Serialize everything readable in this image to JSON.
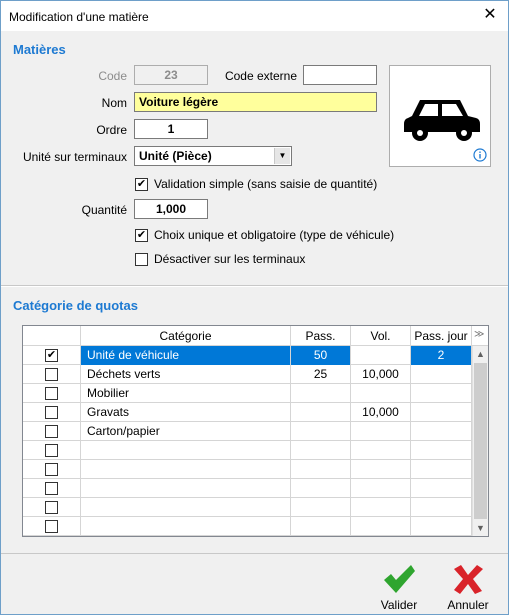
{
  "window": {
    "title": "Modification d'une matière",
    "close_glyph": "✕"
  },
  "matieres": {
    "section_title": "Matières",
    "code_label": "Code",
    "code_value": "23",
    "code_externe_label": "Code externe",
    "code_externe_value": "",
    "nom_label": "Nom",
    "nom_value": "Voiture légère",
    "ordre_label": "Ordre",
    "ordre_value": "1",
    "unite_label": "Unité sur terminaux",
    "unite_value": "Unité (Pièce)",
    "validation_simple_label": "Validation simple (sans saisie de quantité)",
    "validation_simple_checked": true,
    "quantite_label": "Quantité",
    "quantite_value": "1,000",
    "choix_unique_label": "Choix unique et obligatoire (type de véhicule)",
    "choix_unique_checked": true,
    "desactiver_label": "Désactiver sur les terminaux",
    "desactiver_checked": false,
    "image_icon": "car-icon",
    "info_icon": "info-icon"
  },
  "quotas": {
    "section_title": "Catégorie de quotas",
    "columns": [
      "",
      "Catégorie",
      "Pass.",
      "Vol.",
      "Pass. jour"
    ],
    "rows": [
      {
        "checked": true,
        "categorie": "Unité de véhicule",
        "pass": "50",
        "vol": "",
        "pass_jour": "2",
        "selected": true
      },
      {
        "checked": false,
        "categorie": "Déchets verts",
        "pass": "25",
        "vol": "10,000",
        "pass_jour": ""
      },
      {
        "checked": false,
        "categorie": "Mobilier",
        "pass": "",
        "vol": "",
        "pass_jour": ""
      },
      {
        "checked": false,
        "categorie": "Gravats",
        "pass": "",
        "vol": "10,000",
        "pass_jour": ""
      },
      {
        "checked": false,
        "categorie": "Carton/papier",
        "pass": "",
        "vol": "",
        "pass_jour": ""
      },
      {
        "checked": false,
        "categorie": "",
        "pass": "",
        "vol": "",
        "pass_jour": ""
      },
      {
        "checked": false,
        "categorie": "",
        "pass": "",
        "vol": "",
        "pass_jour": ""
      },
      {
        "checked": false,
        "categorie": "",
        "pass": "",
        "vol": "",
        "pass_jour": ""
      },
      {
        "checked": false,
        "categorie": "",
        "pass": "",
        "vol": "",
        "pass_jour": ""
      },
      {
        "checked": false,
        "categorie": "",
        "pass": "",
        "vol": "",
        "pass_jour": ""
      }
    ]
  },
  "actions": {
    "valider_label": "Valider",
    "annuler_label": "Annuler",
    "valider_icon": "checkmark-icon",
    "annuler_icon": "x-icon"
  },
  "colors": {
    "accent": "#1e7ad2",
    "selection": "#0078d7",
    "valider": "#2fa52f",
    "annuler": "#d9232a",
    "nom_bg": "#ffff9c"
  }
}
